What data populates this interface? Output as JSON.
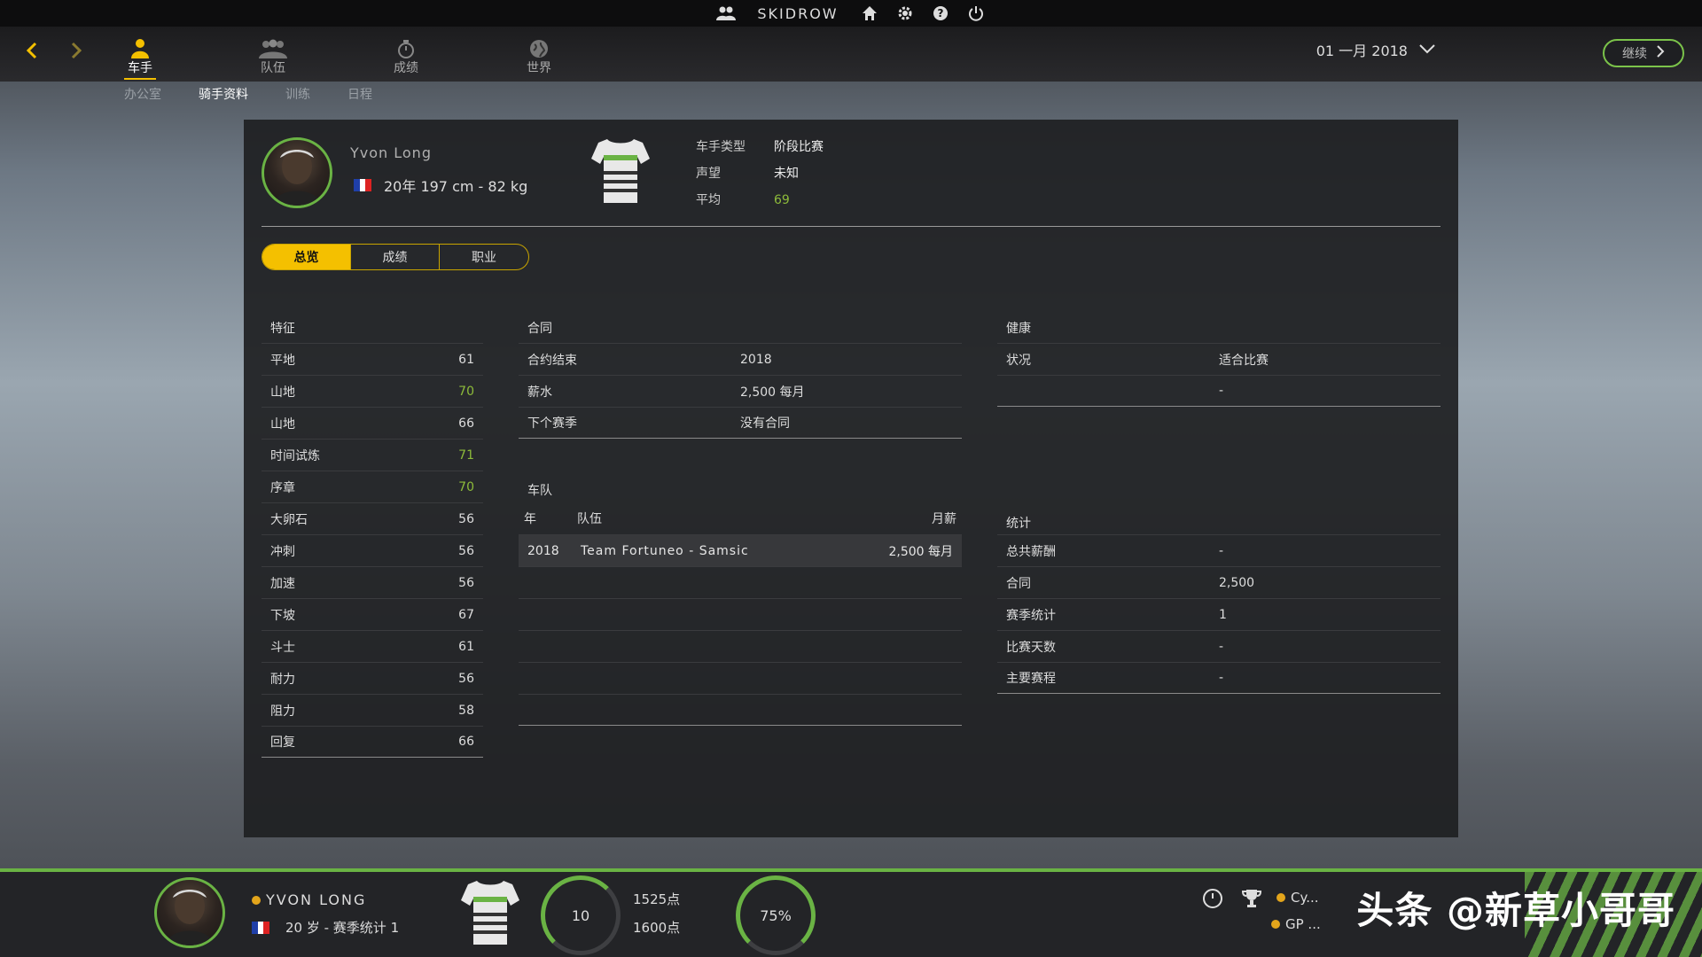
{
  "topbar": {
    "title": "SKIDROW"
  },
  "nav": {
    "tabs": [
      {
        "label": "车手",
        "active": true
      },
      {
        "label": "队伍",
        "active": false
      },
      {
        "label": "成绩",
        "active": false
      },
      {
        "label": "世界",
        "active": false
      }
    ],
    "date": "01 一月 2018",
    "continue": "继续"
  },
  "subnav": {
    "items": [
      "办公室",
      "骑手资料",
      "训练",
      "日程"
    ],
    "active": "骑手资料"
  },
  "rider": {
    "name": "Yvon Long",
    "meta": "20年  197 cm - 82 kg",
    "type_label": "车手类型",
    "type_value": "阶段比赛",
    "reputation_label": "声望",
    "reputation_value": "未知",
    "average_label": "平均",
    "average_value": "69"
  },
  "profile_tabs": [
    "总览",
    "成绩",
    "职业"
  ],
  "attributes": {
    "title": "特征",
    "rows": [
      {
        "name": "平地",
        "value": "61",
        "green": false
      },
      {
        "name": "山地",
        "value": "70",
        "green": true
      },
      {
        "name": "山地",
        "value": "66",
        "green": false
      },
      {
        "name": "时间试炼",
        "value": "71",
        "green": true
      },
      {
        "name": "序章",
        "value": "70",
        "green": true
      },
      {
        "name": "大卵石",
        "value": "56",
        "green": false
      },
      {
        "name": "冲刺",
        "value": "56",
        "green": false
      },
      {
        "name": "加速",
        "value": "56",
        "green": false
      },
      {
        "name": "下坡",
        "value": "67",
        "green": false
      },
      {
        "name": "斗士",
        "value": "61",
        "green": false
      },
      {
        "name": "耐力",
        "value": "56",
        "green": false
      },
      {
        "name": "阻力",
        "value": "58",
        "green": false
      },
      {
        "name": "回复",
        "value": "66",
        "green": false
      }
    ]
  },
  "contract": {
    "title": "合同",
    "rows": [
      {
        "k": "合约结束",
        "v": "2018"
      },
      {
        "k": "薪水",
        "v": "2,500  每月"
      },
      {
        "k": "下个赛季",
        "v": "没有合同"
      }
    ]
  },
  "team": {
    "title": "车队",
    "headers": {
      "year": "年",
      "team": "队伍",
      "salary": "月薪"
    },
    "rows": [
      {
        "year": "2018",
        "team": "Team Fortuneo - Samsic",
        "salary": "2,500  每月"
      }
    ]
  },
  "health": {
    "title": "健康",
    "rows": [
      {
        "k": "状况",
        "v": "适合比赛"
      },
      {
        "k": "",
        "v": "-"
      }
    ]
  },
  "stats": {
    "title": "统计",
    "rows": [
      {
        "k": "总共薪酬",
        "v": "-"
      },
      {
        "k": "合同",
        "v": "2,500"
      },
      {
        "k": "赛季统计",
        "v": "1"
      },
      {
        "k": "比赛天数",
        "v": "-"
      },
      {
        "k": "主要赛程",
        "v": "-"
      }
    ]
  },
  "bottom": {
    "name": "YVON LONG",
    "meta": "20 岁 - 赛季统计 1",
    "rank": "10",
    "points_a": "1525点",
    "points_b": "1600点",
    "percent": "75%",
    "race_1": "Cy...",
    "race_2": "GP ...",
    "watermark": "头条 @新草小哥哥"
  },
  "colors": {
    "accent": "#f4c000",
    "green": "#6ab344",
    "value_green": "#8dbb3a"
  }
}
